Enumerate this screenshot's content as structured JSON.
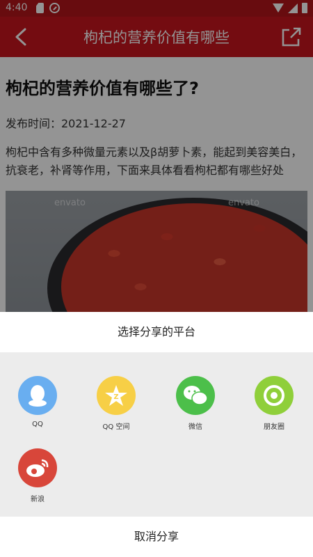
{
  "status_bar": {
    "time": "4:40"
  },
  "app_bar": {
    "title": "枸杞的营养价值有哪些"
  },
  "article": {
    "title": "枸杞的营养价值有哪些了?",
    "date": "发布时间：2021-12-27",
    "summary": "枸杞中含有多种微量元素以及β胡萝卜素，能起到美容美白，抗衰老，补肾等作用，下面来具体看看枸杞都有哪些好处",
    "image_watermark": "envato"
  },
  "share_sheet": {
    "header": "选择分享的平台",
    "cancel": "取消分享",
    "platforms": [
      {
        "label": "QQ",
        "icon": "qq-icon",
        "color": "#69aef0"
      },
      {
        "label": "QQ 空间",
        "icon": "qzone-icon",
        "color": "#f7cf46"
      },
      {
        "label": "微信",
        "icon": "wechat-icon",
        "color": "#4cbf4a"
      },
      {
        "label": "朋友圈",
        "icon": "moments-icon",
        "color": "#8fcf3a"
      },
      {
        "label": "新浪",
        "icon": "weibo-icon",
        "color": "#d8463a"
      }
    ]
  }
}
